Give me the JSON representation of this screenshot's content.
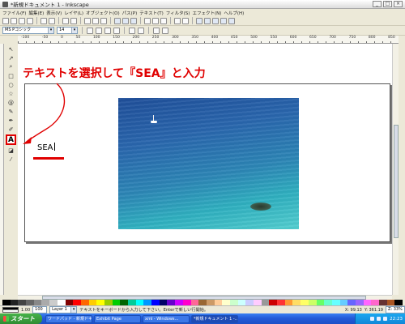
{
  "window": {
    "title": "*新規ドキュメント 1 - Inkscape"
  },
  "menu": [
    "ファイル(F)",
    "編集(E)",
    "表示(V)",
    "レイヤ(L)",
    "オブジェクト(O)",
    "パス(P)",
    "テキスト(T)",
    "フィルタ(S)",
    "エフェクト(N)",
    "ヘルプ(H)"
  ],
  "controls": {
    "font_family": "MS Pゴシック",
    "font_size": "14"
  },
  "ruler": {
    "ticks": [
      "-100",
      "-50",
      "0",
      "50",
      "100",
      "150",
      "200",
      "250",
      "300",
      "350",
      "400",
      "450",
      "500",
      "550",
      "600",
      "650",
      "700",
      "750",
      "800",
      "850"
    ]
  },
  "instruction": "テキストを選択して『SEA』と入力",
  "canvas": {
    "typed_text": "SEA"
  },
  "status": {
    "stroke_width": "1.00",
    "opacity": "100",
    "layer": "Layer 1",
    "message": "テキストをキーボードから入力して下さい。Enterで新しい行開始。",
    "x": "X: 99.13",
    "y": "Y: 361.19",
    "zoom": "Z: 33%"
  },
  "taskbar": {
    "start_label": "スタート",
    "tasks": [
      "ワードパッド - 新規ドキュメント",
      "Exhibit Page",
      "xml - Windows...",
      "*新規ドキュメント 1 -..."
    ],
    "clock": "22:23"
  },
  "colors": {
    "accent": "#e00000",
    "taskbar": "#225ad8",
    "sea_deep": "#1f4f9a",
    "sea_shallow": "#54cfd0"
  },
  "tools": [
    "select-icon",
    "node-icon",
    "zoom-icon",
    "rect-icon",
    "ellipse-icon",
    "star-icon",
    "spiral-icon",
    "pencil-icon",
    "pen-icon",
    "text-icon",
    "gradient-icon",
    "dropper-icon"
  ]
}
